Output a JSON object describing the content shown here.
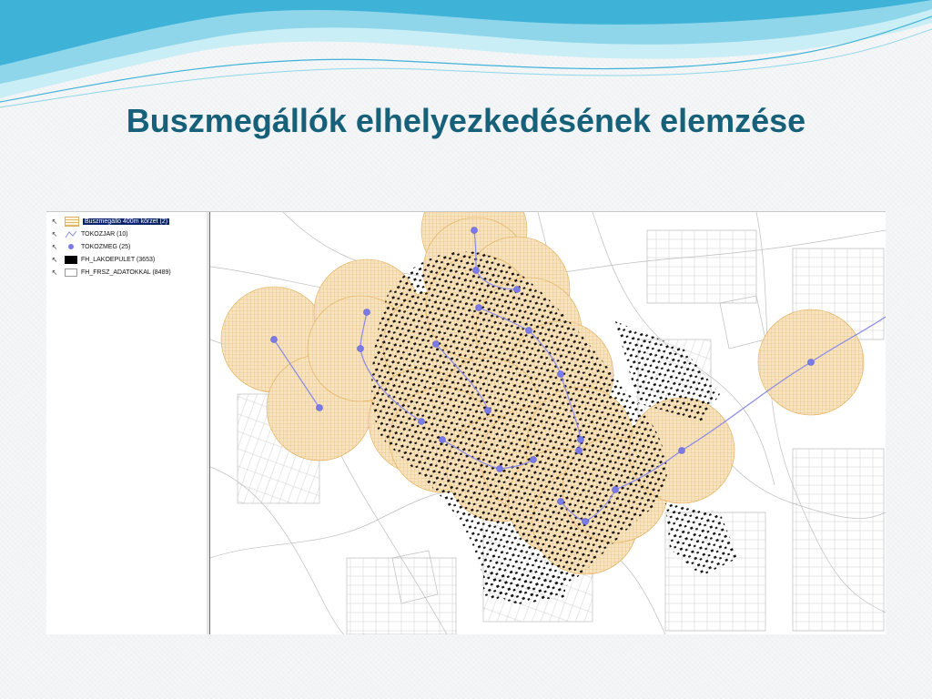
{
  "slide": {
    "title": "Buszmegállók elhelyezkedésének elemzése",
    "title_color": "#17607a",
    "accent_colors": [
      "#3fb2d8",
      "#8fd6ea",
      "#c9eef6"
    ]
  },
  "toc": {
    "layers": [
      {
        "label": "Buszmegálló 400m körzet (2)",
        "symbol": "buffer-grid",
        "selected": true
      },
      {
        "label": "TOKOZJAR (10)",
        "symbol": "line-icon"
      },
      {
        "label": "TOKOZMEG (25)",
        "symbol": "point-icon"
      },
      {
        "label": "FH_LAKOEPULET (3653)",
        "symbol": "black-fill"
      },
      {
        "label": "FH_FRSZ_ADATOKKAL (8489)",
        "symbol": "white-fill"
      }
    ]
  },
  "map": {
    "colors": {
      "buffer_fill": "#f7e2bd",
      "buffer_grid": "#e9b35a",
      "route_line": "#8a8ae8",
      "stop_point": "#7b7be8",
      "building": "#000000",
      "parcel_line": "#b7b7b7"
    }
  }
}
